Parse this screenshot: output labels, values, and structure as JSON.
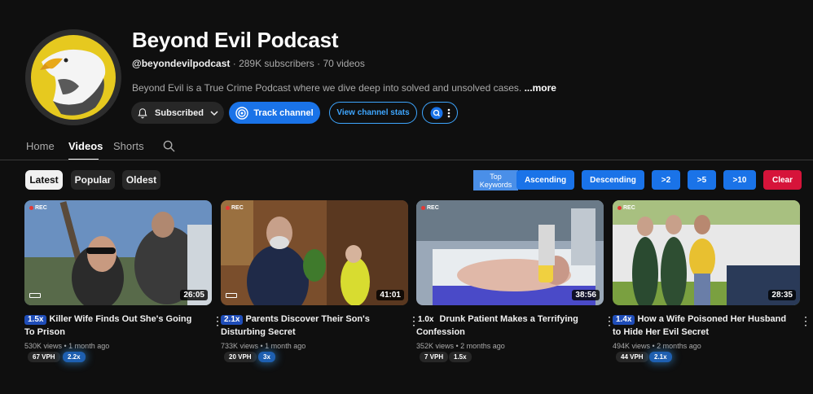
{
  "channel": {
    "name": "Beyond Evil Podcast",
    "handle": "@beyondevilpodcast",
    "stats": " · 289K subscribers · 70 videos",
    "description": "Beyond Evil is a True Crime Podcast where we dive deep into solved and unsolved cases.",
    "more_label": " ...more",
    "subscribed_label": "Subscribed",
    "track_label": "Track channel",
    "stats_label": "View channel stats"
  },
  "tabs": [
    "Home",
    "Videos",
    "Shorts"
  ],
  "sort_chips": [
    "Latest",
    "Popular",
    "Oldest"
  ],
  "filters": {
    "top_keywords": [
      "Top",
      "Keywords"
    ],
    "ascending": "Ascending",
    "descending": "Descending",
    "gt2": ">2",
    "gt5": ">5",
    "gt10": ">10",
    "clear": "Clear"
  },
  "colors": {
    "accent": "#1a73e8",
    "clear": "#d6143a",
    "ratio_badge": "#1e5fb0"
  },
  "videos": [
    {
      "multiplier": "1.5x",
      "title": "Killer Wife Finds Out She's Going To Prison",
      "duration": "26:05",
      "meta": "530K views • 1 month ago",
      "vph": "67 VPH",
      "ratio": "2.2x",
      "rec": "REC",
      "highlight": true,
      "ratio_glow": true
    },
    {
      "multiplier": "2.1x",
      "title": "Parents Discover Their Son's Disturbing Secret",
      "duration": "41:01",
      "meta": "733K views • 1 month ago",
      "vph": "20 VPH",
      "ratio": "3x",
      "rec": "REC",
      "highlight": true,
      "ratio_glow": true
    },
    {
      "multiplier": "1.0x",
      "title": "Drunk Patient Makes a Terrifying Confession",
      "duration": "38:56",
      "meta": "352K views • 2 months ago",
      "vph": "7 VPH",
      "ratio": "1.5x",
      "rec": "REC",
      "highlight": false,
      "ratio_glow": false
    },
    {
      "multiplier": "1.4x",
      "title": "How a Wife Poisoned Her Husband to Hide Her Evil Secret",
      "duration": "28:35",
      "meta": "494K views • 2 months ago",
      "vph": "44 VPH",
      "ratio": "2.1x",
      "rec": "REC",
      "highlight": true,
      "ratio_glow": true
    }
  ]
}
